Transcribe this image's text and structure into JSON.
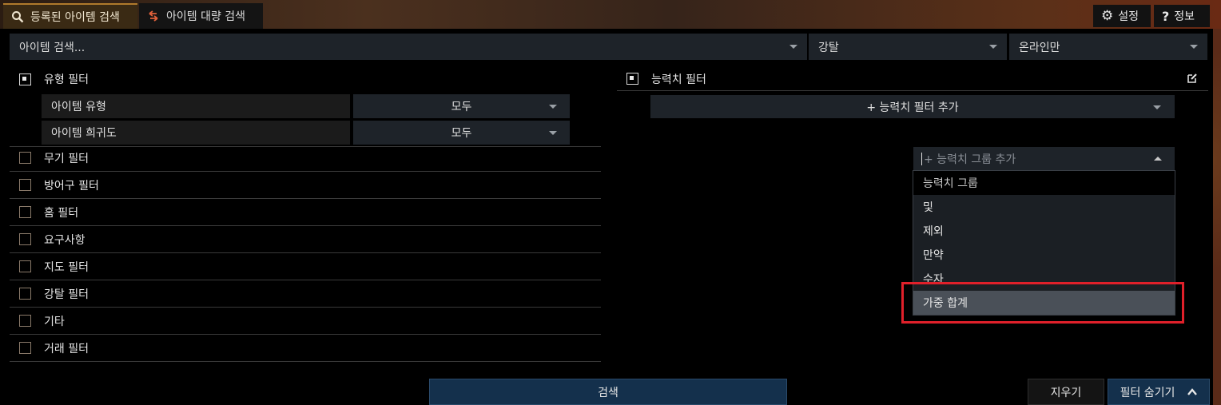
{
  "tabs": [
    {
      "label": "등록된 아이템 검색",
      "icon": "search-icon",
      "active": true
    },
    {
      "label": "아이템 대량 검색",
      "icon": "exchange-arrows-icon",
      "active": false
    }
  ],
  "top_buttons": {
    "settings": {
      "label": "설정",
      "icon": "gear-icon"
    },
    "about": {
      "label": "정보",
      "icon": "question-icon"
    }
  },
  "search": {
    "item_placeholder": "아이템 검색...",
    "category": "강탈",
    "status": "온라인만"
  },
  "type_filter": {
    "label": "유형 필터",
    "rows": [
      {
        "label": "아이템 유형",
        "value": "모두"
      },
      {
        "label": "아이템 희귀도",
        "value": "모두"
      }
    ]
  },
  "filter_groups": [
    "무기 필터",
    "방어구 필터",
    "홈 필터",
    "요구사항",
    "지도 필터",
    "강탈 필터",
    "기타",
    "거래 필터"
  ],
  "stat_filter": {
    "label": "능력치 필터",
    "add_label": "+ 능력치 필터 추가",
    "group_placeholder": "+ 능력치 그룹 추가",
    "dropdown_header": "능력치 그룹",
    "options": [
      "및",
      "제외",
      "만약",
      "수자",
      "가중 합계"
    ],
    "highlighted": "가중 합계"
  },
  "actions": {
    "search": "검색",
    "clear": "지우기",
    "hide_filters": "필터 숨기기"
  },
  "colors": {
    "highlight_box": "#e0202a",
    "search_button": "#14304c",
    "active_tab_accent": "#b07a2c"
  }
}
